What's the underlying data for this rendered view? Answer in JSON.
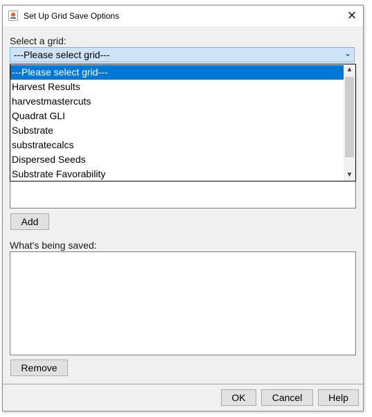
{
  "window": {
    "title": "Set Up Grid Save Options",
    "close_glyph": "✕"
  },
  "grid_select": {
    "label": "Select a grid:",
    "selected": "---Please select grid---",
    "options": [
      "---Please select grid---",
      "Harvest Results",
      "harvestmastercuts",
      "Quadrat GLI",
      "Substrate",
      "substratecalcs",
      "Dispersed Seeds",
      "Substrate Favorability"
    ]
  },
  "buttons": {
    "add": "Add",
    "remove": "Remove",
    "ok": "OK",
    "cancel": "Cancel",
    "help": "Help"
  },
  "saved": {
    "label": "What's being saved:"
  },
  "colors": {
    "selection": "#0078d7",
    "combo_bg": "#cfe3f7",
    "dialog_bg": "#f0f0f0"
  }
}
